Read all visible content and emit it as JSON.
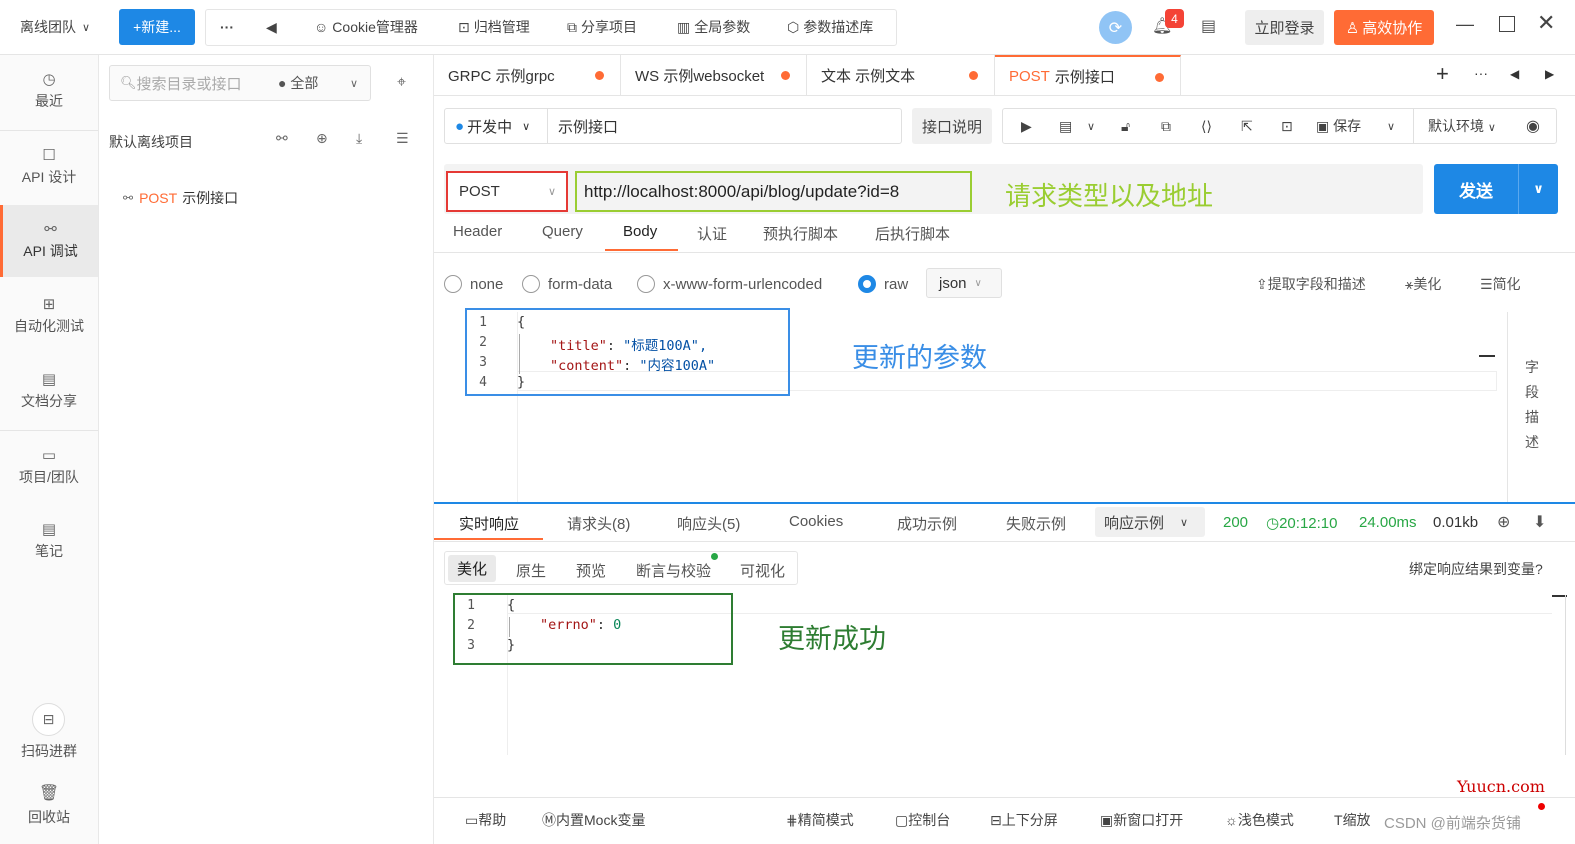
{
  "topbar": {
    "team": "离线团队",
    "new_label": "+新建...",
    "more": "···",
    "back": "◀",
    "items": [
      "Cookie管理器",
      "归档管理",
      "分享项目",
      "全局参数",
      "参数描述库"
    ],
    "badge": "4",
    "login": "立即登录",
    "collab": "高效协作"
  },
  "sidebar": {
    "items": [
      "最近",
      "API 设计",
      "API 调试",
      "自动化测试",
      "文档分享",
      "项目/团队",
      "笔记"
    ],
    "scan": "扫码进群",
    "trash": "回收站"
  },
  "tree": {
    "search_placeholder": "搜索目录或接口",
    "filter": "● 全部",
    "project": "默认离线项目",
    "item_method": "POST",
    "item_name": "示例接口"
  },
  "tabs": [
    {
      "label": "GRPC 示例grpc"
    },
    {
      "label": "WS 示例websocket"
    },
    {
      "label": "文本 示例文本"
    },
    {
      "method": "POST",
      "name": "示例接口"
    }
  ],
  "request": {
    "status": "开发中",
    "name": "示例接口",
    "doc_btn": "接口说明",
    "save": "保存",
    "env": "默认环境",
    "method": "POST",
    "url": "http://localhost:8000/api/blog/update?id=8",
    "send": "发送",
    "tabs": [
      "Header",
      "Query",
      "Body",
      "认证",
      "预执行脚本",
      "后执行脚本"
    ],
    "body_types": [
      "none",
      "form-data",
      "x-www-form-urlencoded",
      "raw"
    ],
    "raw_type": "json",
    "actions": [
      "提取字段和描述",
      "美化",
      "简化"
    ],
    "field_desc": [
      "字",
      "段",
      "描",
      "述"
    ],
    "body_lines": [
      {
        "n": "1",
        "t": "{"
      },
      {
        "n": "2",
        "k": "\"title\"",
        "v": "\"标题100A\","
      },
      {
        "n": "3",
        "k": "\"content\"",
        "v": "\"内容100A\""
      },
      {
        "n": "4",
        "t": "}"
      }
    ]
  },
  "response": {
    "tabs": [
      "实时响应",
      "请求头(8)",
      "响应头(5)",
      "Cookies",
      "成功示例",
      "失败示例"
    ],
    "example": "响应示例",
    "status": "200",
    "time": "20:12:10",
    "duration": "24.00ms",
    "size": "0.01kb",
    "view_tabs": [
      "美化",
      "原生",
      "预览",
      "断言与校验",
      "可视化"
    ],
    "bind": "绑定响应结果到变量?",
    "lines": [
      {
        "n": "1",
        "t": "{"
      },
      {
        "n": "2",
        "k": "\"errno\"",
        "v": "0"
      },
      {
        "n": "3",
        "t": "}"
      }
    ]
  },
  "annotations": {
    "method_url": "请求类型以及地址",
    "params": "更新的参数",
    "success": "更新成功"
  },
  "footer": {
    "items": [
      "帮助",
      "内置Mock变量",
      "精简模式",
      "控制台",
      "上下分屏",
      "新窗口打开",
      "浅色模式",
      "缩放"
    ],
    "watermark": "Yuucn.com",
    "credit": "CSDN @前端杂货铺"
  },
  "colors": {
    "accent": "#ff6b35",
    "primary": "#1e88e5",
    "success": "#28a745"
  }
}
